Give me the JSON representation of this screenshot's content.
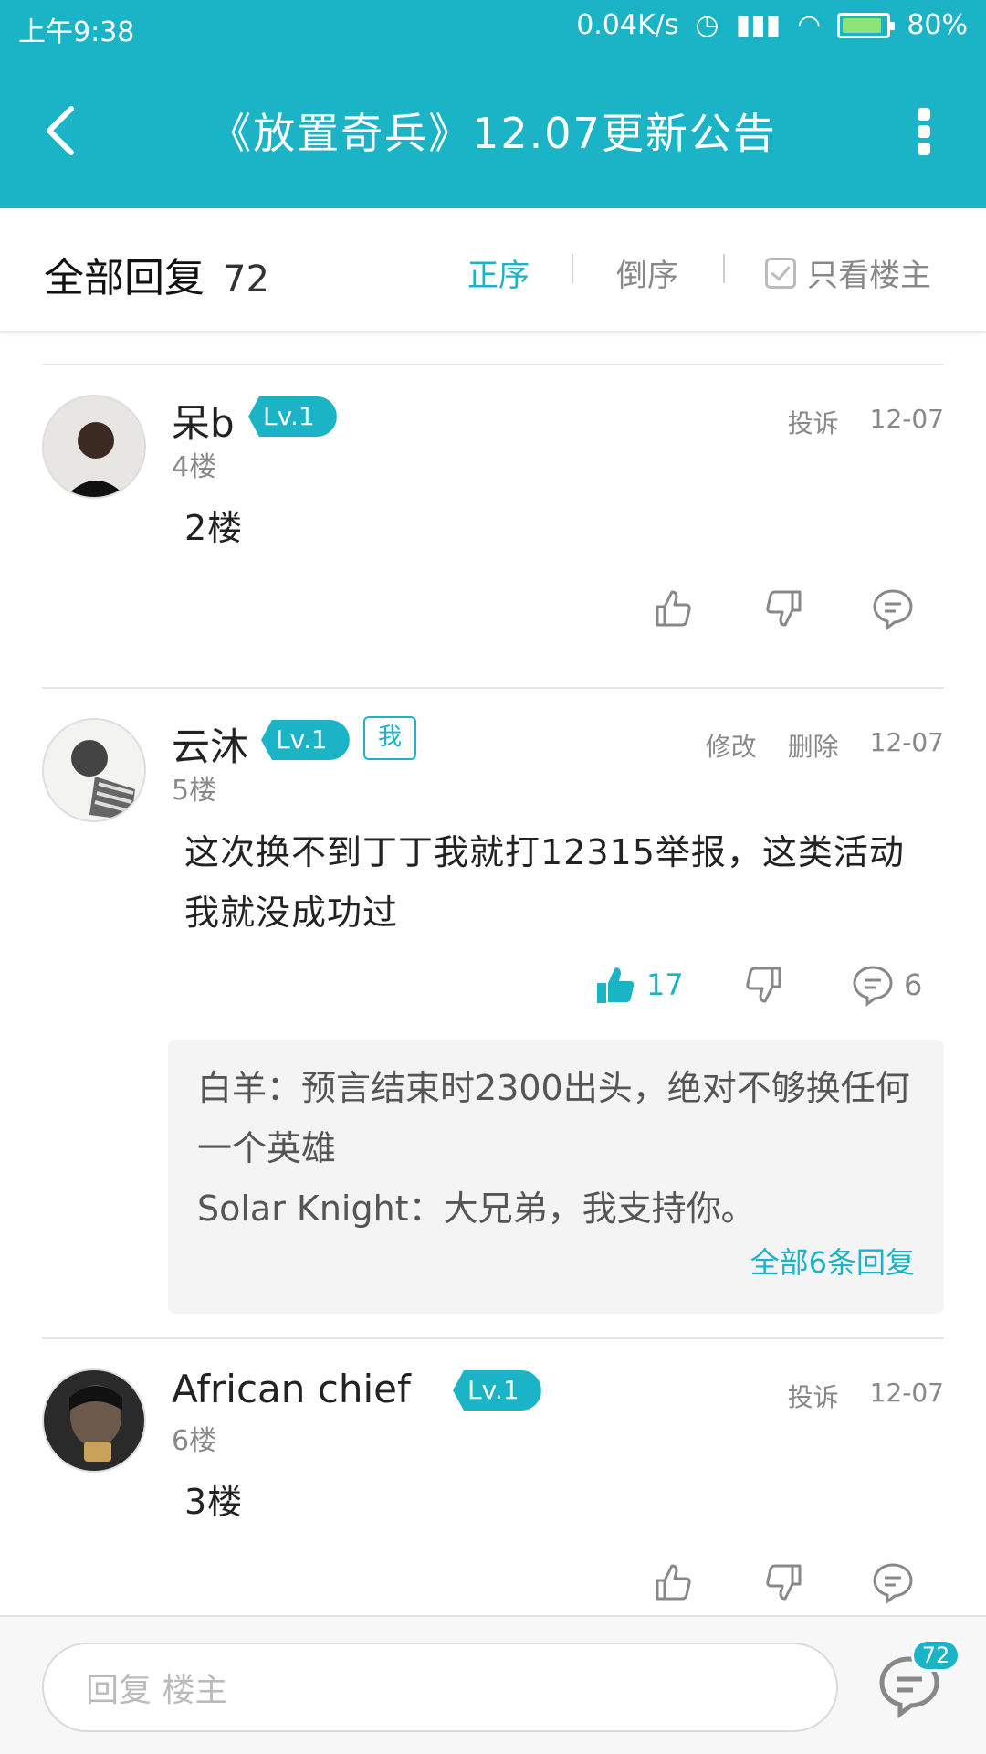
{
  "status": {
    "time": "上午9:38",
    "speed": "0.04K/s",
    "battery": "80%"
  },
  "header": {
    "title": "《放置奇兵》12.07更新公告"
  },
  "sort": {
    "label": "全部回复",
    "count": "72",
    "asc": "正序",
    "desc": "倒序",
    "owner_only": "只看楼主"
  },
  "posts": [
    {
      "user": "呆b",
      "level": "Lv.1",
      "floor": "4楼",
      "actions": [
        "投诉"
      ],
      "date": "12-07",
      "content": "2楼",
      "likes": "",
      "comments": ""
    },
    {
      "user": "云沐",
      "level": "Lv.1",
      "me_badge": "我",
      "floor": "5楼",
      "actions": [
        "修改",
        "删除"
      ],
      "date": "12-07",
      "content": "这次换不到丁丁我就打12315举报，这类活动我就没成功过",
      "likes": "17",
      "comments": "6",
      "replies": [
        "白羊：预言结束时2300出头，绝对不够换任何一个英雄",
        "Solar Knight：大兄弟，我支持你。"
      ],
      "all_replies": "全部6条回复"
    },
    {
      "user": "African chief",
      "level": "Lv.1",
      "floor": "6楼",
      "actions": [
        "投诉"
      ],
      "date": "12-07",
      "content": "3楼",
      "likes": "",
      "comments": ""
    }
  ],
  "bottom": {
    "placeholder": "回复  楼主",
    "comment_count": "72"
  },
  "colors": {
    "accent": "#1bb3c6"
  }
}
